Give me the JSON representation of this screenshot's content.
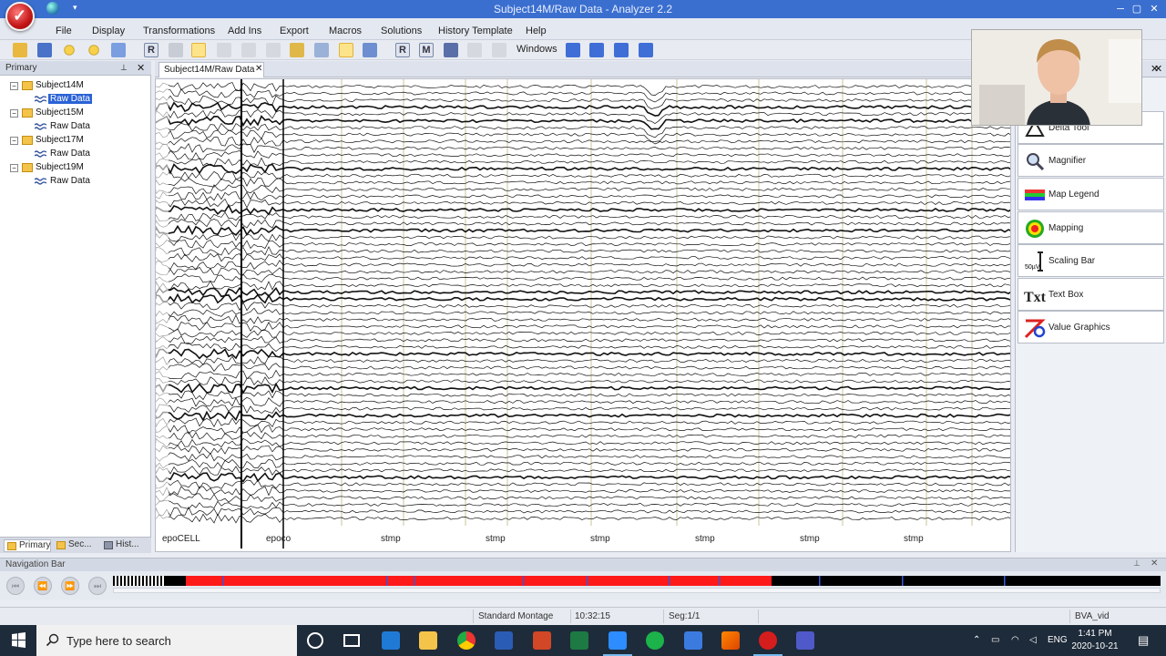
{
  "window": {
    "title": "Subject14M/Raw Data - Analyzer 2.2"
  },
  "menu": [
    "File",
    "Display",
    "Transformations",
    "Add Ins",
    "Export",
    "Macros",
    "Solutions",
    "History Template",
    "Help"
  ],
  "toolbar": {
    "windows_label": "Windows"
  },
  "primary_panel": {
    "title": "Primary",
    "tree": [
      {
        "subject": "Subject14M",
        "child": "Raw Data",
        "selected": true
      },
      {
        "subject": "Subject15M",
        "child": "Raw Data",
        "selected": false
      },
      {
        "subject": "Subject17M",
        "child": "Raw Data",
        "selected": false
      },
      {
        "subject": "Subject19M",
        "child": "Raw Data",
        "selected": false
      }
    ],
    "tabs": [
      "Primary",
      "Sec...",
      "Hist..."
    ]
  },
  "document": {
    "tab_label": "Subject14M/Raw Data"
  },
  "eeg": {
    "markers": [
      "epoCELL",
      "epoco",
      "stmp",
      "stmp",
      "stmp",
      "stmp",
      "stmp",
      "stmp"
    ]
  },
  "tools": [
    {
      "label": "Delta Tool",
      "icon": "delta-tool-icon"
    },
    {
      "label": "Magnifier",
      "icon": "magnifier-icon"
    },
    {
      "label": "Map Legend",
      "icon": "map-legend-icon"
    },
    {
      "label": "Mapping",
      "icon": "mapping-icon"
    },
    {
      "label": "Scaling Bar",
      "icon": "scaling-bar-icon"
    },
    {
      "label": "Text Box",
      "icon": "text-box-icon"
    },
    {
      "label": "Value Graphics",
      "icon": "value-graphics-icon"
    }
  ],
  "navigation": {
    "title": "Navigation Bar"
  },
  "status": {
    "montage": "Standard Montage",
    "time": "10:32:15",
    "segment": "Seg:1/1",
    "file": "BVA_vid"
  },
  "taskbar": {
    "search_placeholder": "Type here to search",
    "language": "ENG",
    "time": "1:41 PM",
    "date": "2020-10-21"
  },
  "colors": {
    "title_bar": "#3a6fd0",
    "selection": "#2b62d6",
    "nav_red": "#ff1a1a",
    "taskbar": "#1e2b3a"
  }
}
